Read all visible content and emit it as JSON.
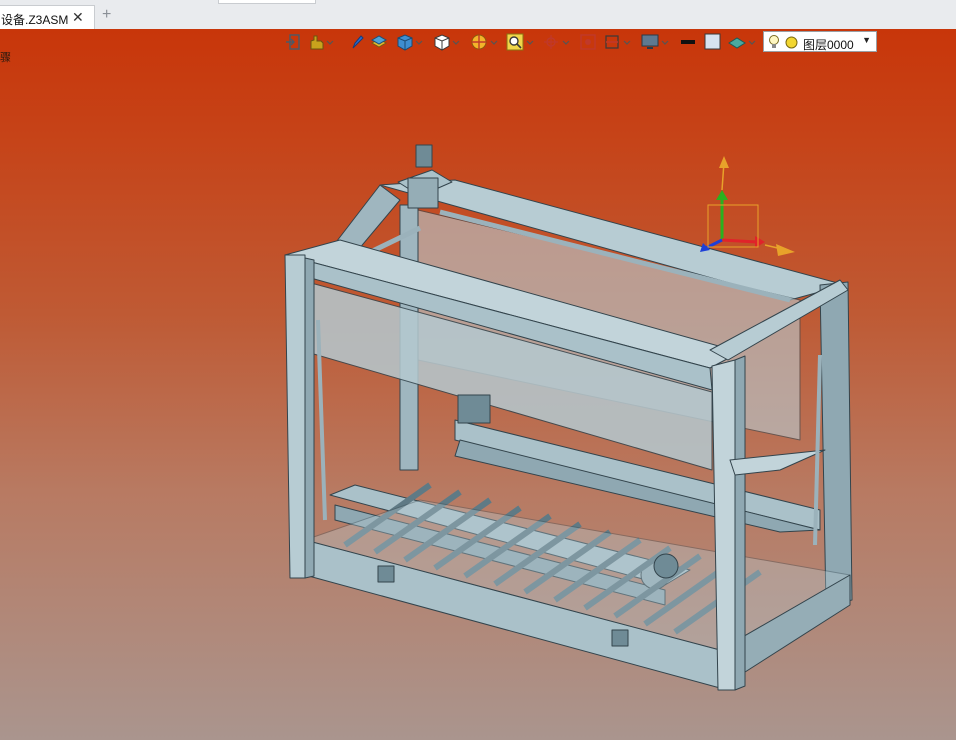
{
  "tabs": [
    {
      "label": "设备.Z3ASM",
      "close": "✕",
      "active": true
    }
  ],
  "new_tab": "+",
  "viewport": {
    "stray_text": "骤",
    "background_top": "#c8360a",
    "background_bottom": "#aa958e"
  },
  "toolbar": {
    "items": [
      {
        "name": "exit-sketch-icon"
      },
      {
        "name": "hand-pan-icon",
        "dropdown": true
      },
      {
        "name": "pen-icon"
      },
      {
        "name": "layer-stack-icon"
      },
      {
        "name": "shaded-cube-icon",
        "dropdown": true
      },
      {
        "name": "wireframe-cube-icon",
        "dropdown": true
      },
      {
        "name": "color-wheel-icon",
        "dropdown": true
      },
      {
        "name": "zoom-box-icon",
        "dropdown": true
      },
      {
        "name": "snap-crosshair-icon",
        "dropdown": true
      },
      {
        "name": "capture-icon"
      },
      {
        "name": "section-plane-icon",
        "dropdown": true
      },
      {
        "name": "monitor-icon",
        "dropdown": true
      },
      {
        "name": "line-color-icon"
      },
      {
        "name": "fill-color-icon"
      },
      {
        "name": "render-plane-icon",
        "dropdown": true
      }
    ],
    "layer": {
      "label": "图层0000",
      "bulb": "💡",
      "color": "#f2d630"
    }
  },
  "model_colors": {
    "frame": "#a9c0c9",
    "frame_dark": "#6f8b96",
    "edge": "#33444c",
    "axis_x": "#e0232a",
    "axis_y": "#29b11f",
    "axis_z": "#1d3fd8",
    "axis_orange": "#e8a22a"
  }
}
